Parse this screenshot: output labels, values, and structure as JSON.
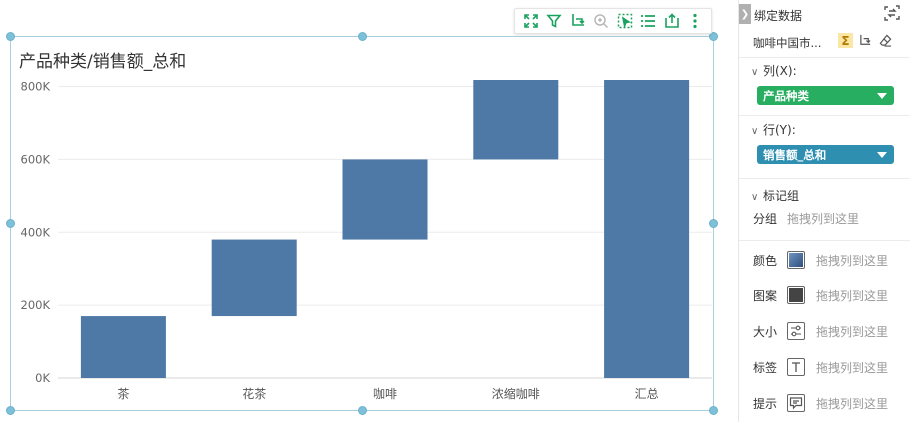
{
  "chart_data": {
    "type": "bar",
    "subtype": "waterfall",
    "title": "产品种类/销售额_总和",
    "categories": [
      "茶",
      "花茶",
      "咖啡",
      "浓缩咖啡",
      "汇总"
    ],
    "bars": [
      {
        "category": "茶",
        "start": 0,
        "end": 170000
      },
      {
        "category": "花茶",
        "start": 170000,
        "end": 380000
      },
      {
        "category": "咖啡",
        "start": 380000,
        "end": 600000
      },
      {
        "category": "浓缩咖啡",
        "start": 600000,
        "end": 818000
      },
      {
        "category": "汇总",
        "start": 0,
        "end": 818000
      }
    ],
    "yticks": [
      0,
      200000,
      400000,
      600000,
      800000
    ],
    "ytick_labels": [
      "0K",
      "200K",
      "400K",
      "600K",
      "800K"
    ],
    "ylim": [
      0,
      818000
    ],
    "bar_color": "#4e79a7",
    "grid": true,
    "legend": "none"
  },
  "toolbar": {
    "icons": [
      "expand-icon",
      "filter-icon",
      "drill-icon",
      "zoom-icon",
      "select-icon",
      "list-icon",
      "export-icon",
      "more-icon"
    ]
  },
  "panel": {
    "title": "绑定数据",
    "dataset": "咖啡中国市...",
    "sigma": "Σ",
    "columns_label": "列(X):",
    "columns_field": "产品种类",
    "rows_label": "行(Y):",
    "rows_field": "销售额_总和",
    "marks_label": "标记组",
    "group_label": "分组",
    "drop_hint": "拖拽列到这里",
    "mark_rows": [
      {
        "label": "颜色",
        "hint": "拖拽列到这里",
        "icon": "color-icon"
      },
      {
        "label": "图案",
        "hint": "拖拽列到这里",
        "icon": "pattern-icon"
      },
      {
        "label": "大小",
        "hint": "拖拽列到这里",
        "icon": "size-icon"
      },
      {
        "label": "标签",
        "hint": "拖拽列到这里",
        "icon": "label-icon"
      },
      {
        "label": "提示",
        "hint": "拖拽列到这里",
        "icon": "tooltip-icon"
      }
    ]
  },
  "colors": {
    "accent_green": "#27ae60",
    "accent_blue": "#2f8fb0",
    "selection_border": "#a7d0de",
    "toolbar_icon": "#1aa260"
  }
}
